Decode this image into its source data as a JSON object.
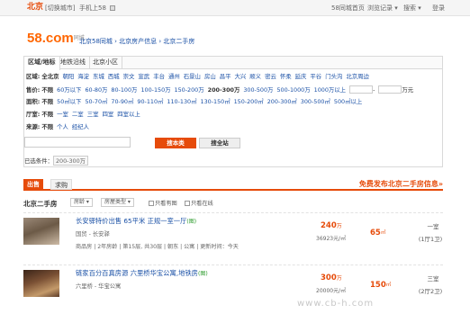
{
  "topbar": {
    "city": "北京",
    "switch": "[切换城市]",
    "mobile": "手机上58",
    "home58": "58同城首页",
    "history": "浏览记录 ▾",
    "search": "搜索 ▾",
    "logout": "登录"
  },
  "logo": {
    "text": "58",
    "sub_text": ".com",
    "tag": "同城"
  },
  "breadcrumb": "北京58同城 › 北京房产信息 › 北京二手房",
  "filter": {
    "tabs": [
      "区域/地标",
      "地铁沿线",
      "北京小区"
    ],
    "rows": [
      {
        "label": "区域:",
        "selected": "全北京",
        "items": [
          "朝阳",
          "海淀",
          "东城",
          "西城",
          "崇文",
          "宣武",
          "丰台",
          "通州",
          "石景山",
          "房山",
          "昌平",
          "大兴",
          "顺义",
          "密云",
          "怀柔",
          "延庆",
          "平谷",
          "门头沟",
          "北京周边"
        ]
      },
      {
        "label": "售价:",
        "selected": "不限",
        "items": [
          "60万以下",
          "60-80万",
          "80-100万",
          "100-150万",
          "150-200万",
          "200-300万",
          "300-500万",
          "500-1000万",
          "1000万以上"
        ],
        "unit": "万元"
      },
      {
        "label": "面积:",
        "selected": "不限",
        "items": [
          "50㎡以下",
          "50-70㎡",
          "70-90㎡",
          "90-110㎡",
          "110-130㎡",
          "130-150㎡",
          "150-200㎡",
          "200-300㎡",
          "300-500㎡",
          "500㎡以上"
        ]
      },
      {
        "label": "厅室:",
        "selected": "不限",
        "items": [
          "一室",
          "二室",
          "三室",
          "四室",
          "四室以上"
        ]
      },
      {
        "label": "来源:",
        "selected": "不限",
        "items": [
          "个人",
          "经纪人"
        ]
      }
    ],
    "find_button": "搜本类",
    "post_button": "搜全站",
    "chosen_label": "已选条件：",
    "chosen_value": "200-300万"
  },
  "list_tabs": {
    "sell": "出售",
    "buy": "求购",
    "free_post": "免费发布北京二手房信息»"
  },
  "list_head": {
    "title": "北京二手房",
    "house_type": "房龄 ▾",
    "room_type": "房屋类型 ▾",
    "only_img": "只看有图",
    "only_online": "只看在线"
  },
  "listings": [
    {
      "title": "长安驿特价出售 65平米 正规一室一厅",
      "img_tag": "(图)",
      "location": "国贸 - 长安驿",
      "meta": "商品房 | 2年房龄 | 第15层, 共30层 | 朝东 | 公寓 | 更新时间：今天",
      "price": "240",
      "price_unit": "万",
      "unit_price": "36923元/㎡",
      "area": "65",
      "area_unit": "㎡",
      "rooms": "一室",
      "layout": "(1厅1卫)"
    },
    {
      "title": "链家百分百真房源 六里桥华宝公寓,地铁房",
      "img_tag": "(图)",
      "location": "六里桥 - 华宝公寓",
      "meta": "",
      "price": "300",
      "price_unit": "万",
      "unit_price": "20000元/㎡",
      "area": "150",
      "area_unit": "㎡",
      "rooms": "三室",
      "layout": "(2厅2卫)"
    }
  ],
  "watermark": "www.cb-h.com"
}
